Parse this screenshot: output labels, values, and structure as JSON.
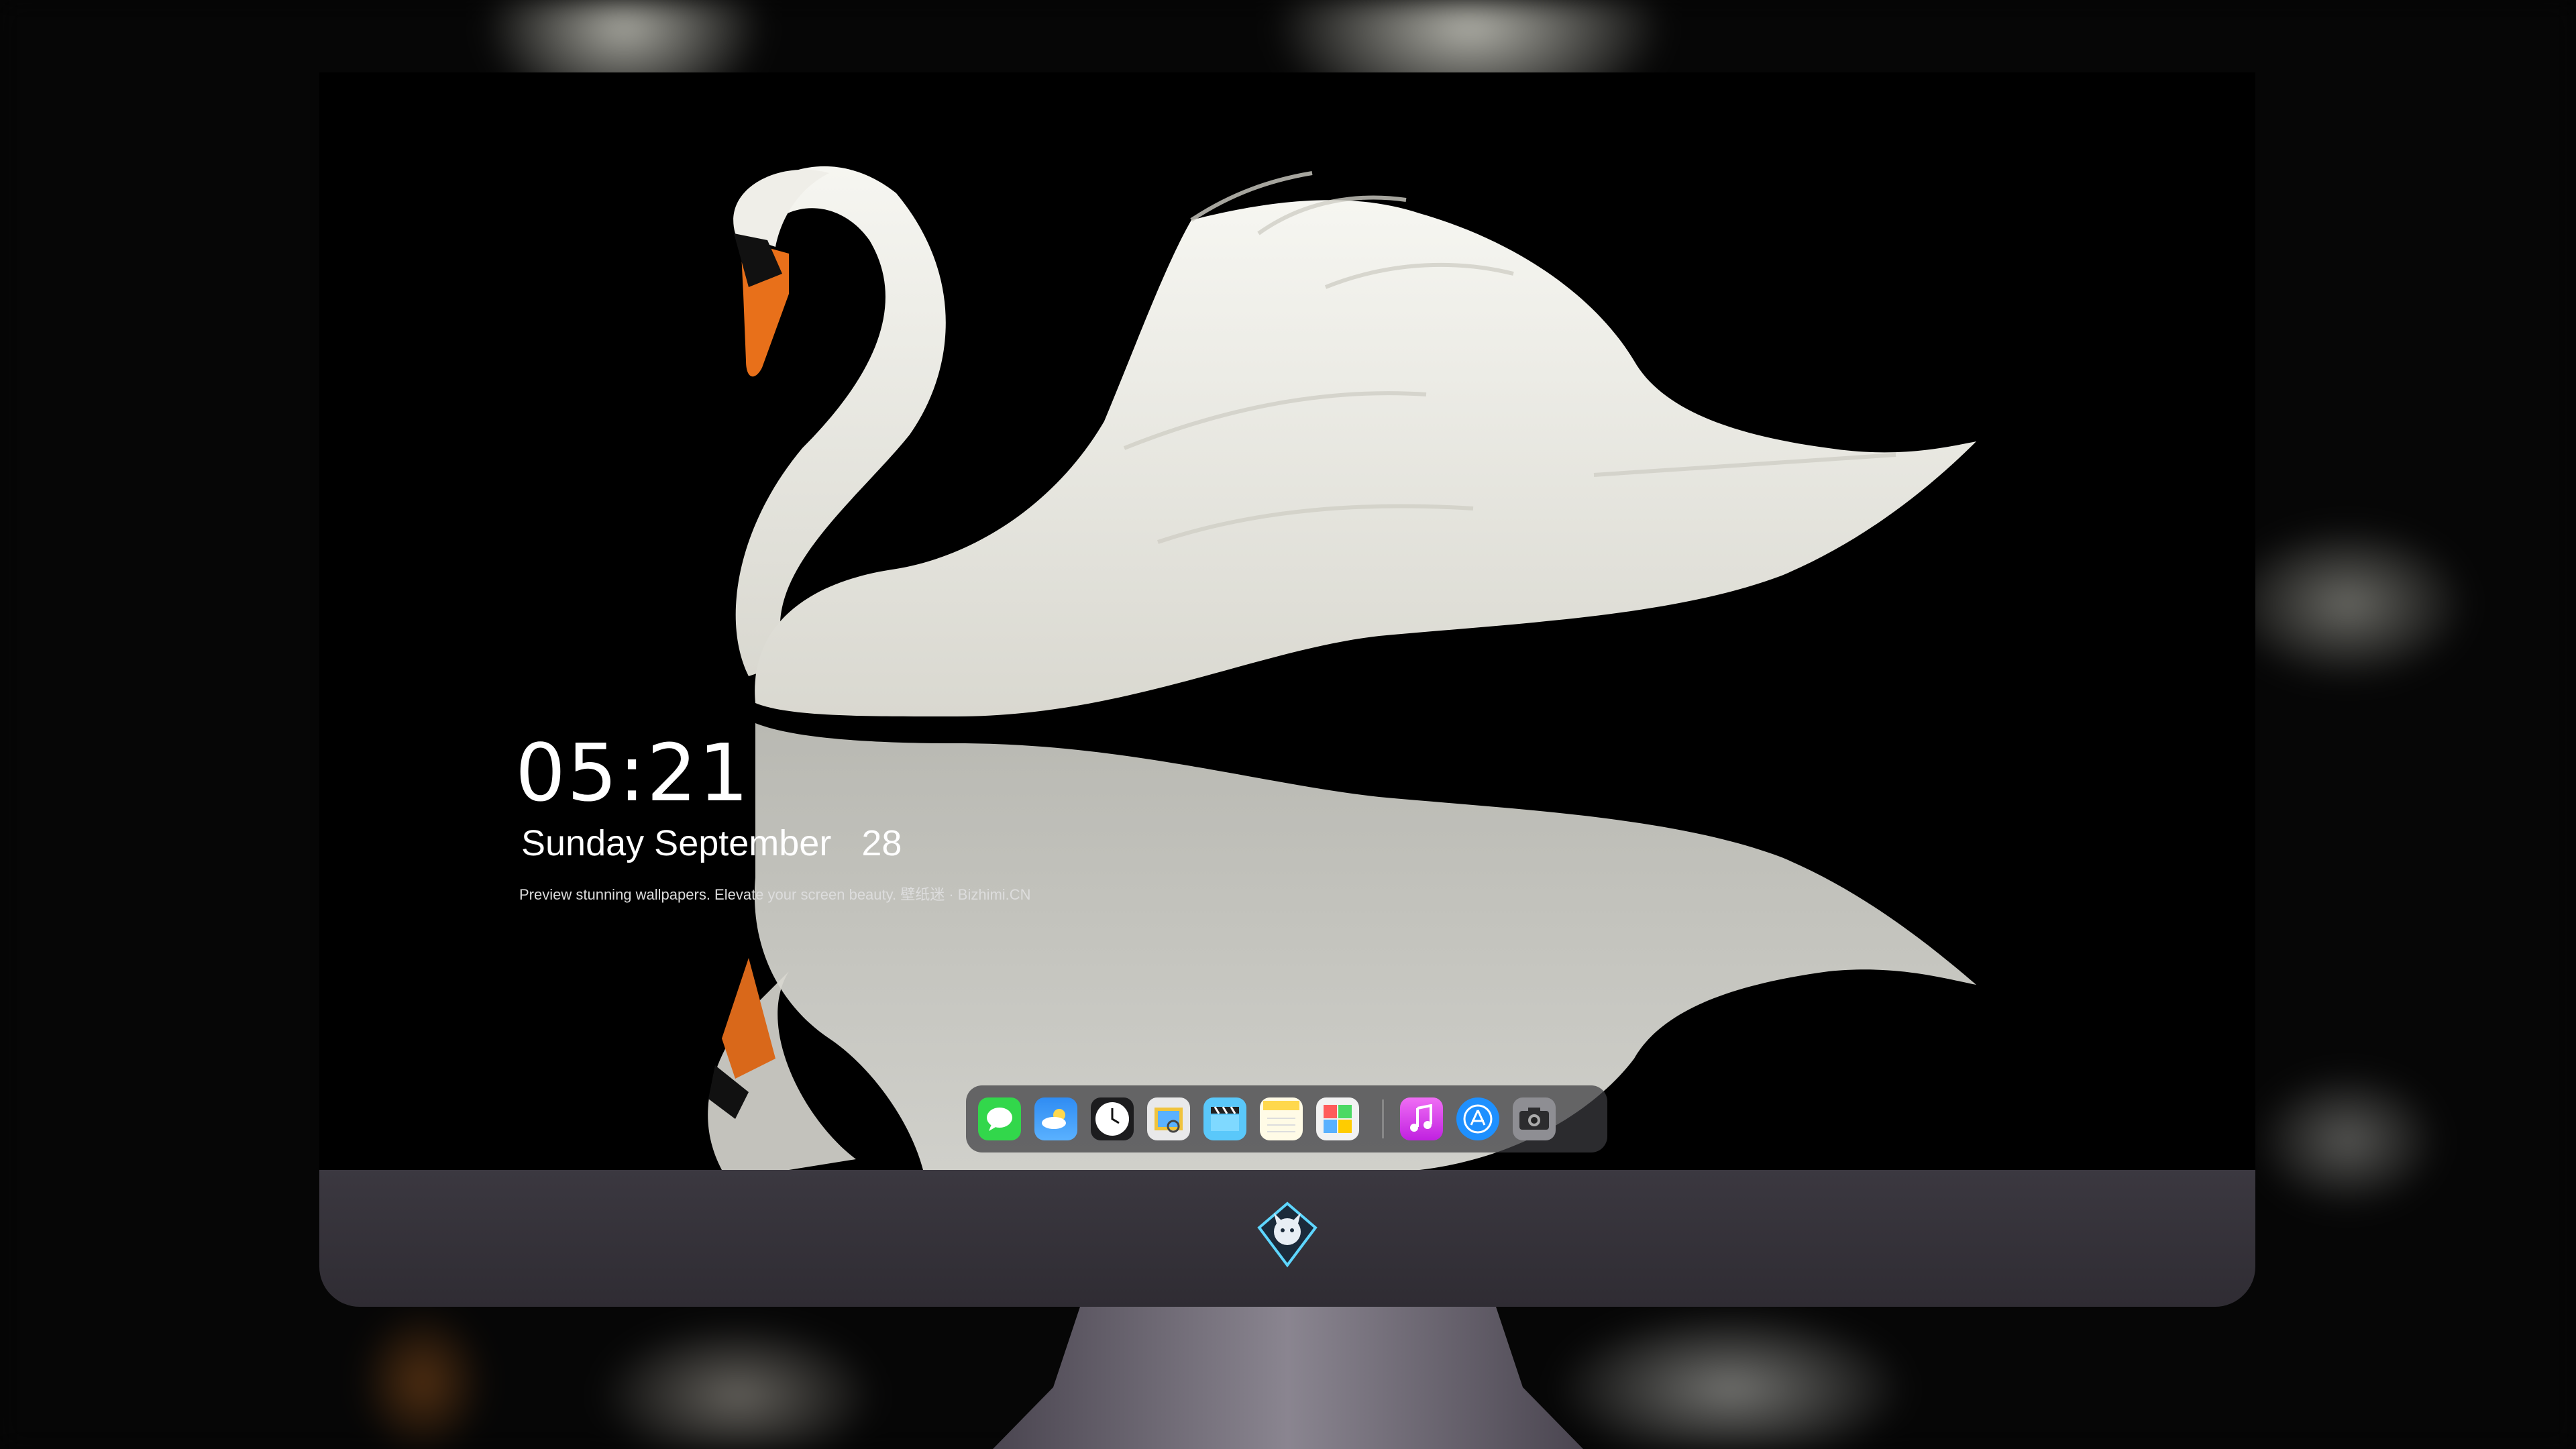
{
  "lock_screen": {
    "time": "05:21",
    "weekday": "Sunday",
    "month": "September",
    "day": "28",
    "caption": "Preview stunning wallpapers. Elevate your screen beauty. 壁纸迷 · Bizhimi.CN"
  },
  "dock": {
    "apps": [
      {
        "name": "messages-icon",
        "color": "#32d74b"
      },
      {
        "name": "weather-icon",
        "color": "#2f8cf3"
      },
      {
        "name": "clock-icon",
        "color": "#1c1c1e"
      },
      {
        "name": "preview-icon",
        "color": "#f0c33c"
      },
      {
        "name": "clips-icon",
        "color": "#5ac8fa"
      },
      {
        "name": "notes-icon",
        "color": "#ffd84d"
      },
      {
        "name": "photo-booth-icon",
        "color": "#f2f2f2"
      },
      {
        "name": "music-icon",
        "color": "#e040fb"
      },
      {
        "name": "app-store-icon",
        "color": "#1e90ff"
      },
      {
        "name": "camera-icon",
        "color": "#8e8e93"
      }
    ]
  },
  "colors": {
    "screen_bg": "#000000",
    "chin": "#34313a",
    "swan": "#f1f0ea",
    "beak": "#e8701a"
  }
}
